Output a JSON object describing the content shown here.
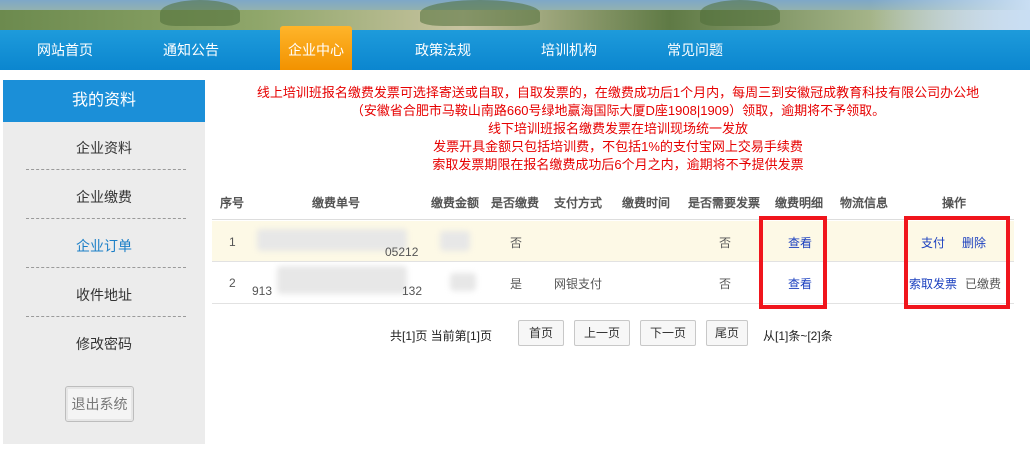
{
  "nav": {
    "items": [
      "网站首页",
      "通知公告",
      "企业中心",
      "政策法规",
      "培训机构",
      "常见问题"
    ],
    "active_index": 2
  },
  "sidebar": {
    "title": "我的资料",
    "items": [
      "企业资料",
      "企业缴费",
      "企业订单",
      "收件地址",
      "修改密码"
    ],
    "active_index": 2,
    "logout_label": "退出系统"
  },
  "notice": {
    "lines": [
      "线上培训班报名缴费发票可选择寄送或自取，自取发票的，在缴费成功后1个月内，每周三到安徽冠成教育科技有限公司办公地",
      "（安徽省合肥市马鞍山南路660号绿地赢海国际大厦D座1908|1909）领取，逾期将不予领取。",
      "线下培训班报名缴费发票在培训现场统一发放",
      "发票开具金额只包括培训费，不包括1%的支付宝网上交易手续费",
      "索取发票期限在报名缴费成功后6个月之内，逾期将不予提供发票"
    ]
  },
  "table": {
    "headers": [
      "序号",
      "缴费单号",
      "缴费金额",
      "是否缴费",
      "支付方式",
      "缴费时间",
      "是否需要发票",
      "缴费明细",
      "物流信息",
      "操作"
    ],
    "rows": [
      {
        "index": "1",
        "order_no_visible": "05212",
        "paid": "否",
        "pay_method": "",
        "need_invoice": "否",
        "detail_link": "查看",
        "actions": [
          "支付",
          "删除"
        ]
      },
      {
        "index": "2",
        "order_no_prefix": "913",
        "order_no_suffix": "132",
        "paid": "是",
        "pay_method": "网银支付",
        "need_invoice": "否",
        "detail_link": "查看",
        "actions": [
          "索取发票",
          "已缴费"
        ]
      }
    ]
  },
  "pager": {
    "summary": "共[1]页  当前第[1]页",
    "first": "首页",
    "prev": "上一页",
    "next": "下一页",
    "last": "尾页",
    "range": "从[1]条~[2]条"
  },
  "colors": {
    "nav_blue": "#0b86cf",
    "nav_active": "#f29200",
    "notice_red": "#e60000",
    "link_blue": "#1a3fbf",
    "highlight_box": "#f0151c"
  }
}
